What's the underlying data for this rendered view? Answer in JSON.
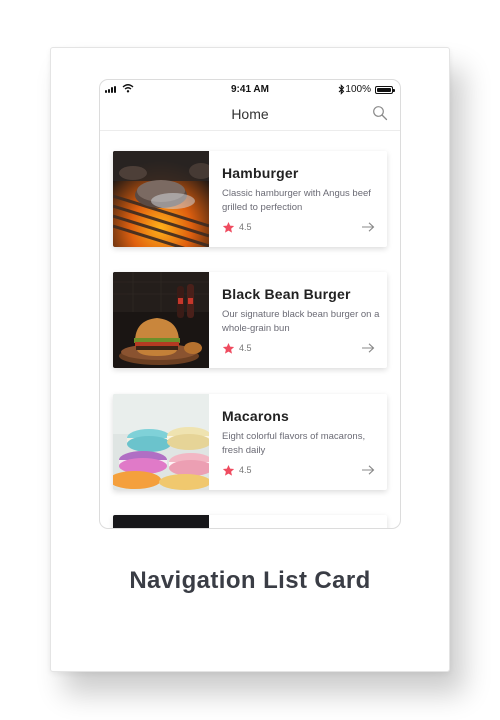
{
  "status_bar": {
    "time": "9:41 AM",
    "battery": "100%"
  },
  "nav": {
    "title": "Home",
    "search_icon": "search-icon"
  },
  "items": [
    {
      "title": "Hamburger",
      "description": "Classic hamburger with Angus beef grilled to perfection",
      "rating": "4.5",
      "image": "grilled-patty-photo"
    },
    {
      "title": "Black Bean Burger",
      "description": "Our signature black bean burger on a whole-grain bun",
      "rating": "4.5",
      "image": "burger-on-board-photo"
    },
    {
      "title": "Macarons",
      "description": "Eight colorful flavors of macarons, fresh daily",
      "rating": "4.5",
      "image": "macarons-photo"
    },
    {
      "title": "",
      "description": "",
      "rating": "",
      "image": "dark-photo"
    }
  ],
  "caption": "Navigation List Card",
  "colors": {
    "star": "#ef4c60",
    "text_dark": "#222222",
    "text_muted": "#6b6b75",
    "caption": "#3a3d45"
  }
}
